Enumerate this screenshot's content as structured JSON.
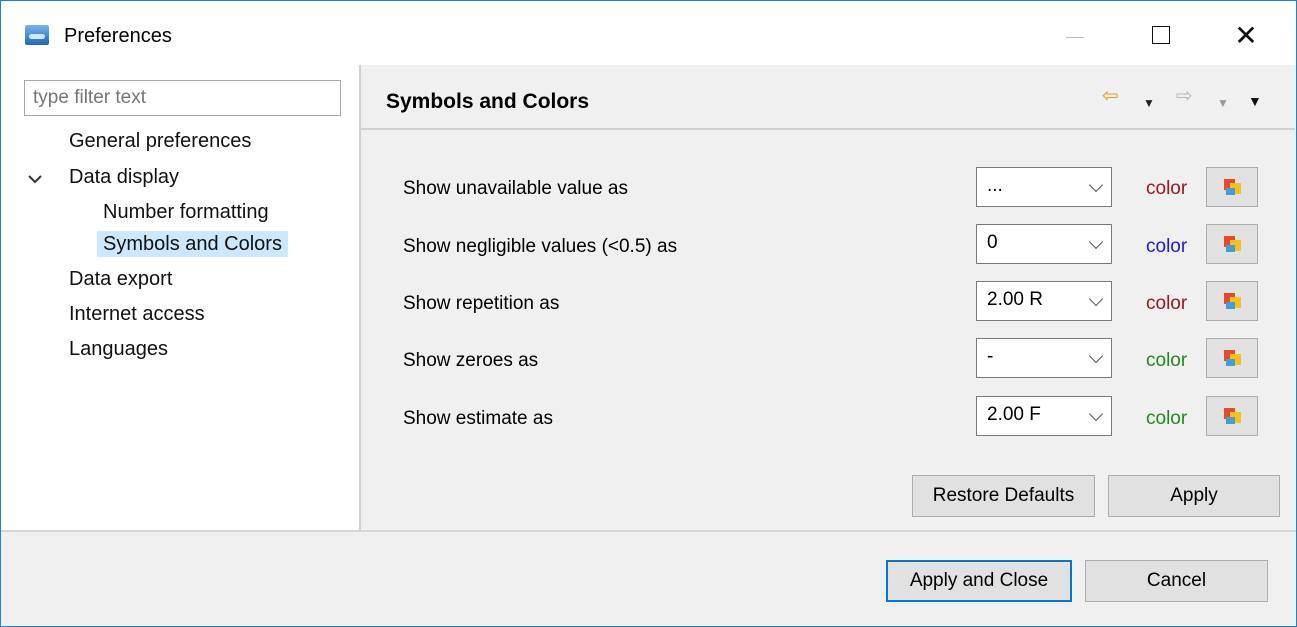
{
  "window": {
    "title": "Preferences"
  },
  "sidebar": {
    "filter_placeholder": "type filter text",
    "items": [
      {
        "label": "General preferences"
      },
      {
        "label": "Data display"
      },
      {
        "label": "Number formatting"
      },
      {
        "label": "Symbols and Colors"
      },
      {
        "label": "Data export"
      },
      {
        "label": "Internet access"
      },
      {
        "label": "Languages"
      }
    ]
  },
  "main": {
    "title": "Symbols and Colors",
    "rows": [
      {
        "label": "Show unavailable value as",
        "value": "...",
        "color_label": "color",
        "color": "#a0141c"
      },
      {
        "label": "Show negligible values (<0.5) as",
        "value": "0",
        "color_label": "color",
        "color": "#1a1ad6"
      },
      {
        "label": "Show repetition as",
        "value": "2.00 R",
        "color_label": "color",
        "color": "#a0141c"
      },
      {
        "label": "Show zeroes as",
        "value": "-",
        "color_label": "color",
        "color": "#1f8a1f"
      },
      {
        "label": "Show estimate as",
        "value": "2.00 F",
        "color_label": "color",
        "color": "#1f8a1f"
      }
    ],
    "restore_defaults_label": "Restore Defaults",
    "apply_label": "Apply"
  },
  "footer": {
    "apply_close_label": "Apply and Close",
    "cancel_label": "Cancel"
  },
  "icons": {
    "app": "preferences-app-icon",
    "back": "back-arrow-icon",
    "forward": "forward-arrow-icon",
    "menu": "view-menu-icon",
    "color_picker": "color-picker-icon"
  },
  "colors": {
    "accent": "#0078d7",
    "selection": "#cce8ff",
    "back_arrow": "#e3a01c"
  }
}
